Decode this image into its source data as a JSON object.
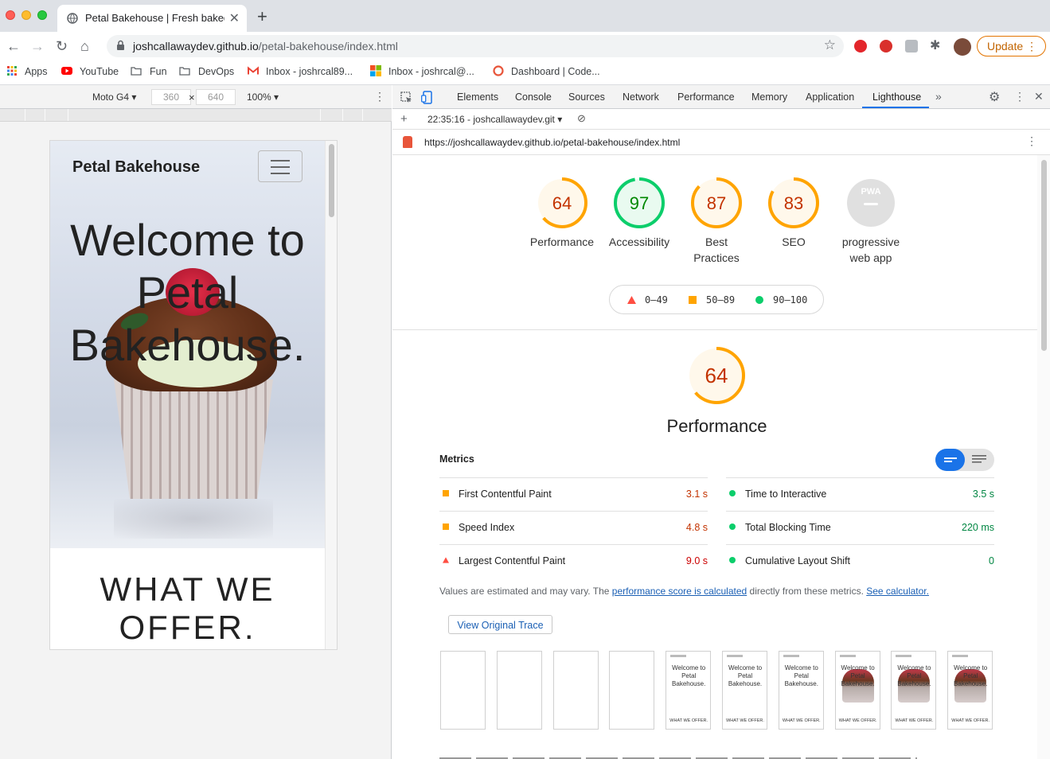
{
  "browser": {
    "tab_title": "Petal Bakehouse | Fresh baked",
    "url_host": "joshcallawaydev.github.io",
    "url_path": "/petal-bakehouse/index.html",
    "update_label": "Update",
    "bookmarks": [
      {
        "label": "Apps",
        "icon": "apps-grid-icon"
      },
      {
        "label": "YouTube",
        "icon": "youtube-icon"
      },
      {
        "label": "Fun",
        "icon": "folder-icon"
      },
      {
        "label": "DevOps",
        "icon": "folder-icon"
      },
      {
        "label": "Inbox - joshrcal89...",
        "icon": "gmail-icon"
      },
      {
        "label": "Inbox - joshrcal@...",
        "icon": "outlook-icon"
      },
      {
        "label": "Dashboard | Code...",
        "icon": "codewars-icon"
      }
    ]
  },
  "device_toolbar": {
    "device": "Moto G4",
    "width": "360",
    "height": "640",
    "zoom": "100%"
  },
  "site": {
    "brand": "Petal Bakehouse",
    "hero_lines": [
      "Welcome to",
      "Petal",
      "Bakehouse."
    ],
    "section_lines": [
      "WHAT WE",
      "OFFER."
    ]
  },
  "devtools": {
    "tabs": [
      "Elements",
      "Console",
      "Sources",
      "Network",
      "Performance",
      "Memory",
      "Application",
      "Lighthouse"
    ],
    "active_tab": "Lighthouse",
    "run_label": "22:35:16 - joshcallawaydev.git",
    "report_url": "https://joshcallawaydev.github.io/petal-bakehouse/index.html"
  },
  "lighthouse": {
    "colors": {
      "fail": "#ff4e42",
      "average": "#ffa400",
      "pass": "#0cce6b"
    },
    "gauges": [
      {
        "score": "64",
        "label_lines": [
          "Performance"
        ],
        "status": "average"
      },
      {
        "score": "97",
        "label_lines": [
          "Accessibility"
        ],
        "status": "pass"
      },
      {
        "score": "87",
        "label_lines": [
          "Best",
          "Practices"
        ],
        "status": "average"
      },
      {
        "score": "83",
        "label_lines": [
          "SEO"
        ],
        "status": "average"
      },
      {
        "score": "PWA",
        "label_lines": [
          "progressive",
          "web app"
        ],
        "status": "na"
      }
    ],
    "legend": {
      "fail": "0–49",
      "average": "50–89",
      "pass": "90–100"
    },
    "category": {
      "score": "64",
      "title": "Performance"
    },
    "metrics_heading": "Metrics",
    "metrics_left": [
      {
        "name": "First Contentful Paint",
        "value": "3.1 s",
        "status": "average"
      },
      {
        "name": "Speed Index",
        "value": "4.8 s",
        "status": "average"
      },
      {
        "name": "Largest Contentful Paint",
        "value": "9.0 s",
        "status": "fail"
      }
    ],
    "metrics_right": [
      {
        "name": "Time to Interactive",
        "value": "3.5 s",
        "status": "pass"
      },
      {
        "name": "Total Blocking Time",
        "value": "220 ms",
        "status": "pass"
      },
      {
        "name": "Cumulative Layout Shift",
        "value": "0",
        "status": "pass"
      }
    ],
    "note_prefix": "Values are estimated and may vary. The ",
    "note_link1": "performance score is calculated",
    "note_middle": " directly from these metrics. ",
    "note_link2": "See calculator.",
    "trace_button": "View Original Trace",
    "filmstrip": {
      "blank_count": 4,
      "text_frame": {
        "title": "Welcome to Petal Bakehouse.",
        "offer": "WHAT WE OFFER."
      },
      "text_only_count": 3,
      "image_count": 3
    }
  }
}
